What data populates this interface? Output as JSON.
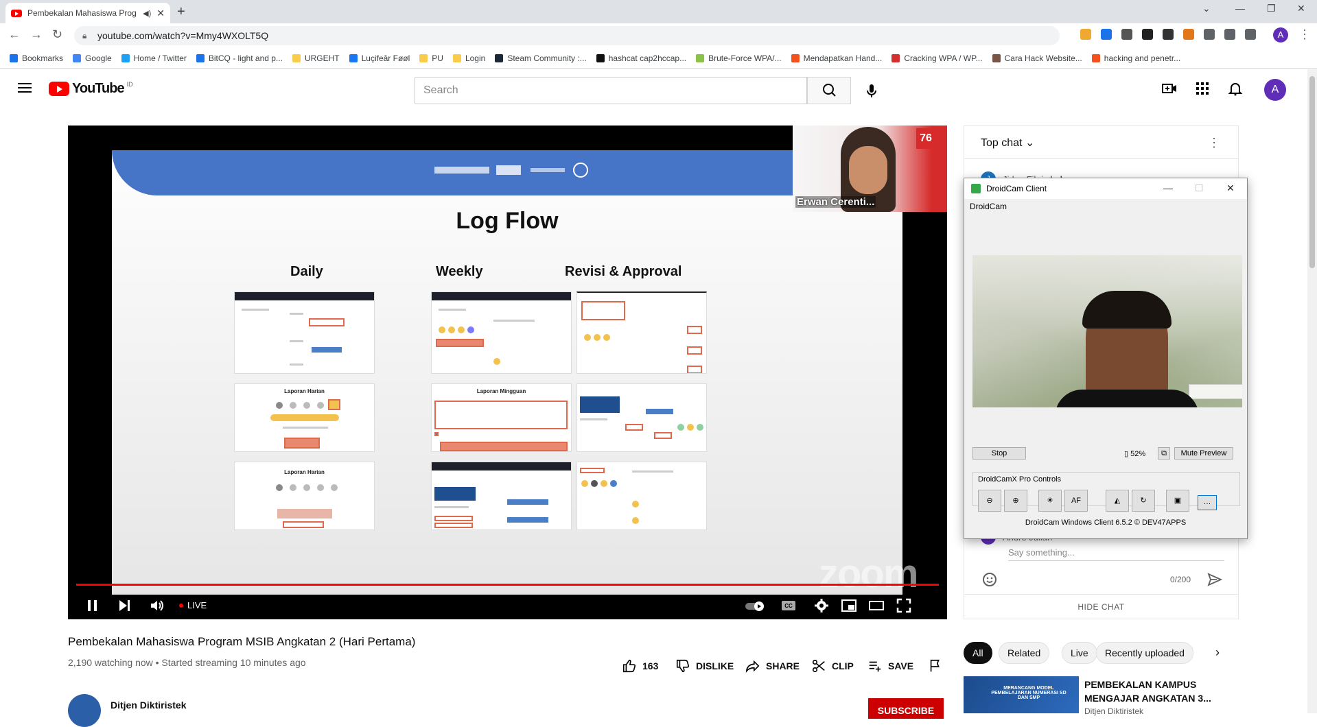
{
  "browser": {
    "tab_title": "Pembekalan Mahasiswa Prog",
    "url": "youtube.com/watch?v=Mmy4WXOLT5Q",
    "profile_initial": "A",
    "bookmarks": [
      {
        "label": "Bookmarks",
        "color": "#1a73e8"
      },
      {
        "label": "Google",
        "color": "#4285f4"
      },
      {
        "label": "Home / Twitter",
        "color": "#1da1f2"
      },
      {
        "label": "BitCQ - light and p...",
        "color": "#1a73e8"
      },
      {
        "label": "URGEHT",
        "color": "#f9cc4b"
      },
      {
        "label": "Luçifeâr Føøl",
        "color": "#1877f2"
      },
      {
        "label": "PU",
        "color": "#f9cc4b"
      },
      {
        "label": "Login",
        "color": "#f9cc4b"
      },
      {
        "label": "Steam Community :...",
        "color": "#1b2838"
      },
      {
        "label": "hashcat cap2hccap...",
        "color": "#111111"
      },
      {
        "label": "Brute-Force WPA/...",
        "color": "#8bc34a"
      },
      {
        "label": "Mendapatkan Hand...",
        "color": "#f4511e"
      },
      {
        "label": "Cracking WPA / WP...",
        "color": "#d32f2f"
      },
      {
        "label": "Cara Hack Website...",
        "color": "#795548"
      },
      {
        "label": "hacking and penetr...",
        "color": "#f4511e"
      }
    ]
  },
  "youtube": {
    "logo_text": "YouTube",
    "country_code": "ID",
    "search_placeholder": "Search",
    "avatar_initial": "A"
  },
  "player": {
    "slide_title": "Log Flow",
    "columns": [
      "Daily",
      "Weekly",
      "Revisi & Approval"
    ],
    "thumb_titles": [
      "Laporan Harian",
      "Laporan Mingguan",
      "Laporan Harian"
    ],
    "speaker_name": "Erwan Cerenti...",
    "live_label": "LIVE",
    "watermark": "zoom",
    "badge_76": "76"
  },
  "video": {
    "title": "Pembekalan Mahasiswa Program MSIB Angkatan 2 (Hari Pertama)",
    "meta": "2,190 watching now • Started streaming 10 minutes ago",
    "likes": "163",
    "dislike_label": "DISLIKE",
    "share_label": "SHARE",
    "clip_label": "CLIP",
    "save_label": "SAVE",
    "channel_name": "Ditjen Diktiristek",
    "subscribe_label": "SUBSCRIBE"
  },
  "chat": {
    "header": "Top chat",
    "messages": [
      {
        "author": "Jidan Fikri",
        "text": "halo",
        "initial": "J"
      },
      {
        "author": "Andre Julian",
        "text": "",
        "initial": "A"
      }
    ],
    "input_placeholder": "Say something...",
    "char_count": "0/200",
    "hide_label": "HIDE CHAT"
  },
  "droidcam": {
    "window_title": "DroidCam Client",
    "menu_label": "DroidCam",
    "stop_label": "Stop",
    "battery": "52%",
    "mute_label": "Mute Preview",
    "controls_label": "DroidCamX Pro Controls",
    "af_label": "AF",
    "version": "DroidCam Windows Client 6.5.2 © DEV47APPS"
  },
  "filters": [
    "All",
    "Related",
    "Live",
    "Recently uploaded"
  ],
  "recommendation": {
    "title": "PEMBEKALAN KAMPUS MENGAJAR ANGKATAN 3...",
    "channel": "Ditjen Diktiristek",
    "thumb_text": "MERANCANG MODEL PEMBELAJARAN NUMERASI SD DAN SMP"
  }
}
